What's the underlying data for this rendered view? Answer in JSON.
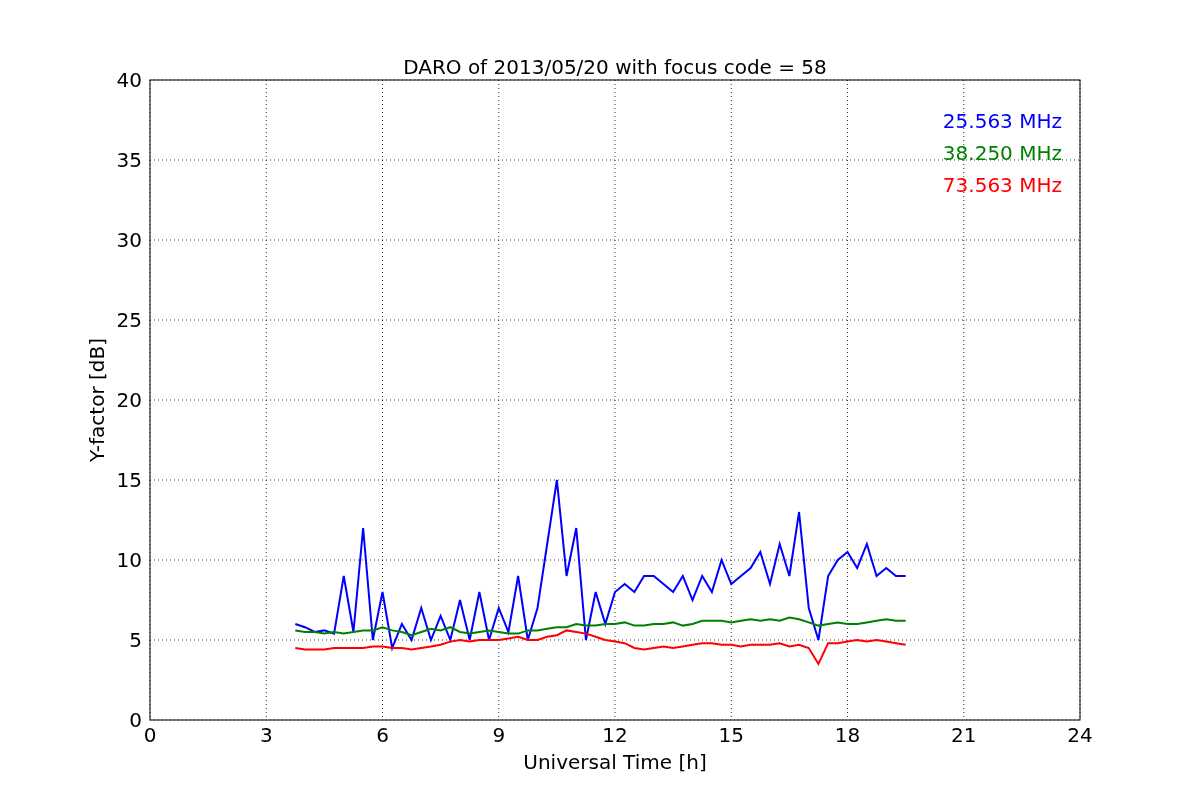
{
  "chart_data": {
    "type": "line",
    "title": "DARO of 2013/05/20 with focus code = 58",
    "xlabel": "Universal Time [h]",
    "ylabel": "Y-factor [dB]",
    "x": [
      3.75,
      4,
      4.25,
      4.5,
      4.75,
      5,
      5.25,
      5.5,
      5.75,
      6,
      6.25,
      6.5,
      6.75,
      7,
      7.25,
      7.5,
      7.75,
      8,
      8.25,
      8.5,
      8.75,
      9,
      9.25,
      9.5,
      9.75,
      10,
      10.25,
      10.5,
      10.75,
      11,
      11.25,
      11.5,
      11.75,
      12,
      12.25,
      12.5,
      12.75,
      13,
      13.25,
      13.5,
      13.75,
      14,
      14.25,
      14.5,
      14.75,
      15,
      15.25,
      15.5,
      15.75,
      16,
      16.25,
      16.5,
      16.75,
      17,
      17.25,
      17.5,
      17.75,
      18,
      18.25,
      18.5,
      18.75,
      19,
      19.25,
      19.5
    ],
    "series": [
      {
        "name": "25.563 MHz",
        "color": "#0000ff",
        "values": [
          6.0,
          5.8,
          5.5,
          5.6,
          5.4,
          9.0,
          5.5,
          12.0,
          5.0,
          8.0,
          4.5,
          6.0,
          5.0,
          7.0,
          5.0,
          6.5,
          5.0,
          7.5,
          5.0,
          8.0,
          5.0,
          7.0,
          5.5,
          9.0,
          5.0,
          7.0,
          11.0,
          15.0,
          9.0,
          12.0,
          5.0,
          8.0,
          6.0,
          8.0,
          8.5,
          8.0,
          9.0,
          9.0,
          8.5,
          8.0,
          9.0,
          7.5,
          9.0,
          8.0,
          10.0,
          8.5,
          9.0,
          9.5,
          10.5,
          8.5,
          11.0,
          9.0,
          13.0,
          7.0,
          5.0,
          9.0,
          10.0,
          10.5,
          9.5,
          11.0,
          9.0,
          9.5,
          9.0,
          9.0
        ]
      },
      {
        "name": "38.250 MHz",
        "color": "#008000",
        "values": [
          5.6,
          5.5,
          5.5,
          5.4,
          5.5,
          5.4,
          5.5,
          5.6,
          5.6,
          5.8,
          5.6,
          5.5,
          5.3,
          5.5,
          5.7,
          5.6,
          5.8,
          5.5,
          5.4,
          5.5,
          5.6,
          5.5,
          5.4,
          5.4,
          5.6,
          5.6,
          5.7,
          5.8,
          5.8,
          6.0,
          5.9,
          5.9,
          6.0,
          6.0,
          6.1,
          5.9,
          5.9,
          6.0,
          6.0,
          6.1,
          5.9,
          6.0,
          6.2,
          6.2,
          6.2,
          6.1,
          6.2,
          6.3,
          6.2,
          6.3,
          6.2,
          6.4,
          6.3,
          6.1,
          5.9,
          6.0,
          6.1,
          6.0,
          6.0,
          6.1,
          6.2,
          6.3,
          6.2,
          6.2
        ]
      },
      {
        "name": "73.563 MHz",
        "color": "#ff0000",
        "values": [
          4.5,
          4.4,
          4.4,
          4.4,
          4.5,
          4.5,
          4.5,
          4.5,
          4.6,
          4.6,
          4.5,
          4.5,
          4.4,
          4.5,
          4.6,
          4.7,
          4.9,
          5.0,
          4.9,
          5.0,
          5.0,
          5.0,
          5.1,
          5.2,
          5.0,
          5.0,
          5.2,
          5.3,
          5.6,
          5.5,
          5.4,
          5.2,
          5.0,
          4.9,
          4.8,
          4.5,
          4.4,
          4.5,
          4.6,
          4.5,
          4.6,
          4.7,
          4.8,
          4.8,
          4.7,
          4.7,
          4.6,
          4.7,
          4.7,
          4.7,
          4.8,
          4.6,
          4.7,
          4.5,
          3.5,
          4.8,
          4.8,
          4.9,
          5.0,
          4.9,
          5.0,
          4.9,
          4.8,
          4.7
        ]
      }
    ],
    "xlim": [
      0,
      24
    ],
    "ylim": [
      0,
      40
    ],
    "xticks": [
      0,
      3,
      6,
      9,
      12,
      15,
      18,
      21,
      24
    ],
    "yticks": [
      0,
      5,
      10,
      15,
      20,
      25,
      30,
      35,
      40
    ],
    "grid": true
  }
}
